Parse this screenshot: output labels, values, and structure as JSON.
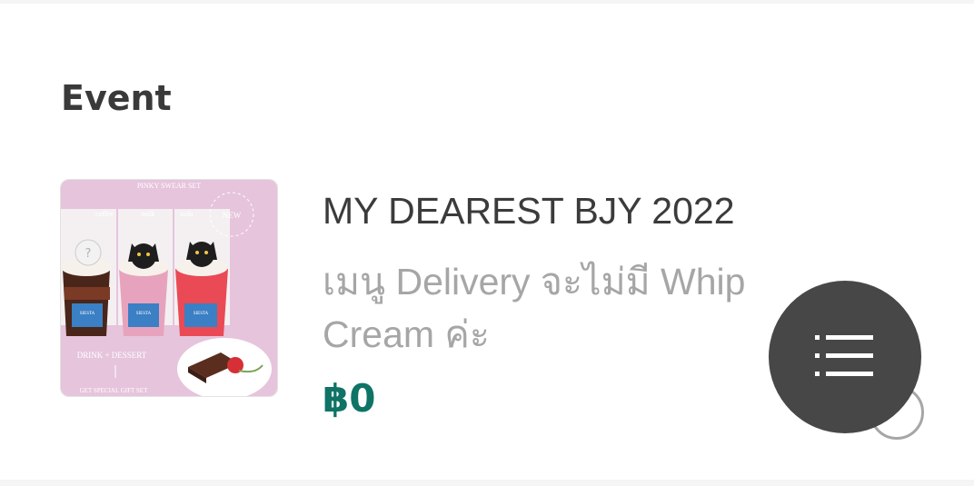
{
  "section": {
    "title": "Event"
  },
  "item": {
    "title": "MY DEAREST BJY 2022",
    "description": "เมนู Delivery จะไม่มี Whip Cream ค่ะ",
    "price": "฿0",
    "image": {
      "header": "PINKY SWEAR SET",
      "labels": [
        "coffee",
        "milk",
        "soda"
      ],
      "cup_brand": "SIESTA",
      "badge": "NEW",
      "footer_main": "DRINK + DESSERT",
      "footer_sub": "GET SPECIAL GIFT SET"
    }
  },
  "fab": {
    "icon": "menu-list-icon",
    "color": "#474747"
  },
  "colors": {
    "price": "#0f7366",
    "title": "#3b3b3b",
    "description": "#a6a6a6"
  }
}
